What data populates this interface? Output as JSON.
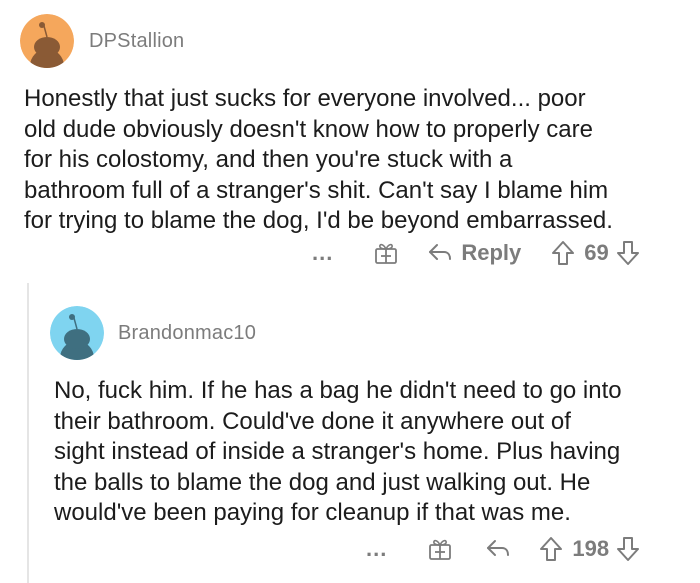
{
  "comments": [
    {
      "username": "DPStallion",
      "body_lines": [
        "Honestly that just sucks for everyone involved... poor",
        "old dude obviously doesn't know how to properly care",
        "for his colostomy, and then you're stuck with a",
        "bathroom full of a stranger's shit. Can't say I blame him",
        "for trying to blame the dog, I'd be beyond embarrassed."
      ],
      "more_label": "...",
      "reply_label": "Reply",
      "votes": "69",
      "avatar_color": "#f5a75c"
    },
    {
      "username": "Brandonmac10",
      "body_lines": [
        "No, fuck him. If he has a bag he didn't need to go into",
        "their bathroom. Could've done it anywhere out of",
        "sight instead of inside a stranger's home. Plus having",
        "the balls to blame the dog and just walking out. He",
        "would've been paying for cleanup if that was me."
      ],
      "more_label": "...",
      "votes": "198",
      "avatar_color": "#7fd4f0"
    }
  ],
  "colors": {
    "meta_gray": "#7c7c7c",
    "text": "#1c1c1c",
    "thread_line": "#e5e5e5"
  }
}
